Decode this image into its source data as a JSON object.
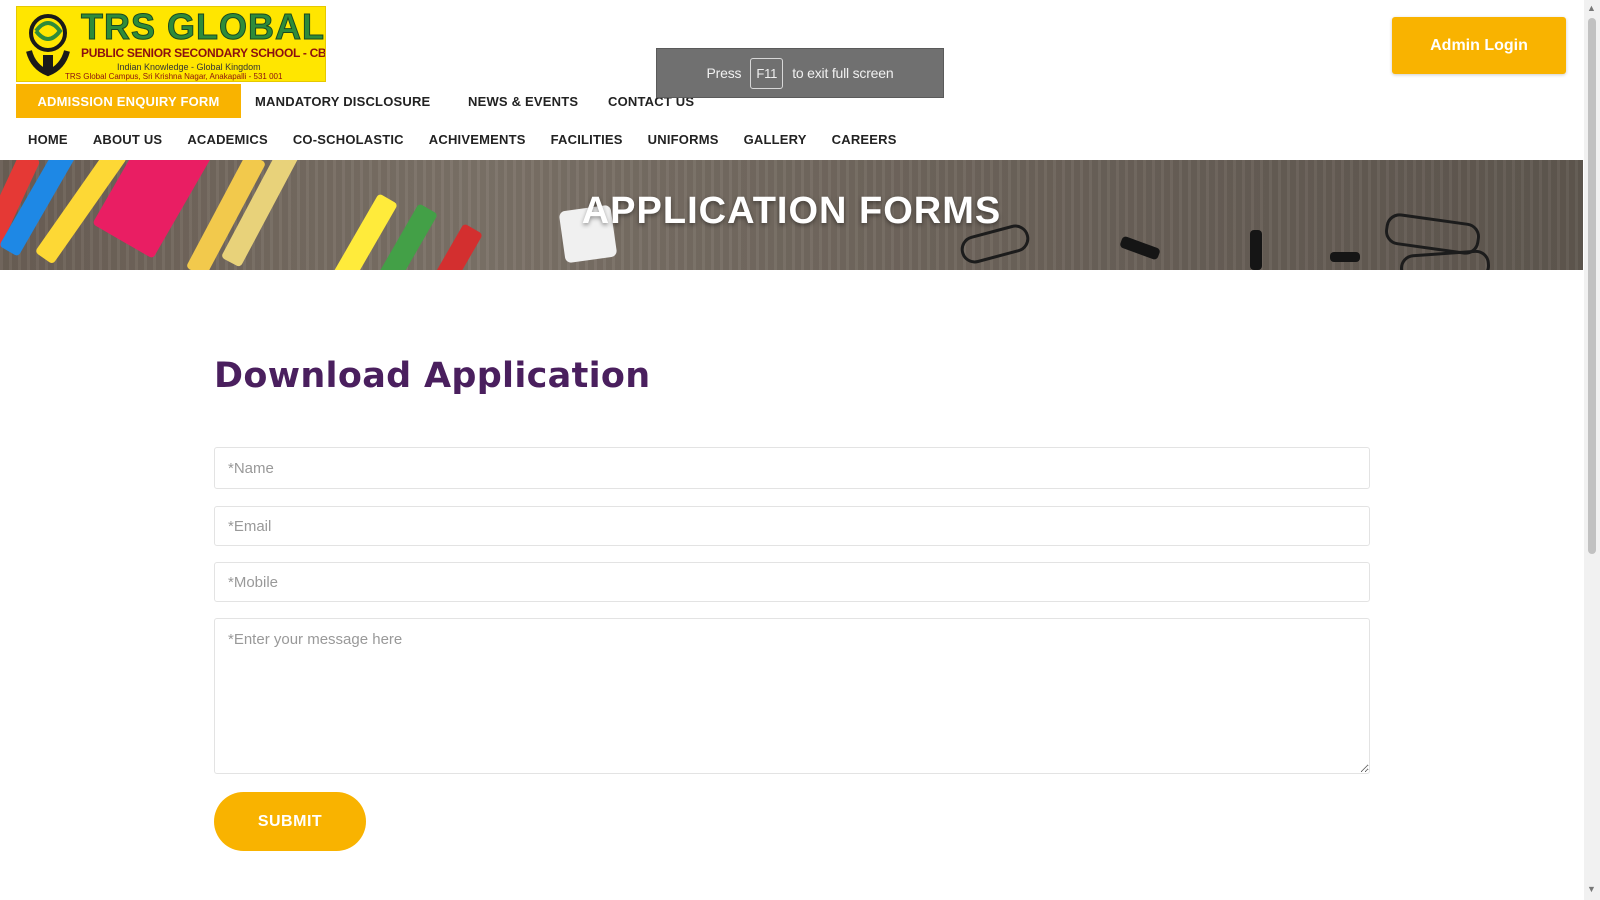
{
  "header": {
    "logo": {
      "title": "TRS GLOBAL",
      "subtitle": "PUBLIC SENIOR SECONDARY SCHOOL - CBSE",
      "tagline": "Indian Knowledge - Global Kingdom",
      "address": "TRS Global Campus, Sri Krishna Nagar, Anakapalli - 531 001"
    },
    "enquiry_label": "ADMISSION ENQUIRY FORM",
    "top_links": [
      "MANDATORY DISCLOSURE",
      "NEWS & EVENTS",
      "CONTACT US"
    ],
    "main_nav": [
      "HOME",
      "ABOUT US",
      "ACADEMICS",
      "CO-SCHOLASTIC",
      "ACHIVEMENTS",
      "FACILITIES",
      "UNIFORMS",
      "GALLERY",
      "CAREERS"
    ],
    "admin_login_label": "Admin Login"
  },
  "fullscreen_toast": {
    "press": "Press",
    "key": "F11",
    "suffix": "to exit full screen"
  },
  "banner": {
    "title": "APPLICATION FORMS"
  },
  "form": {
    "heading": "Download Application",
    "name_placeholder": "*Name",
    "email_placeholder": "*Email",
    "mobile_placeholder": "*Mobile",
    "message_placeholder": "*Enter your message here",
    "submit_label": "SUBMIT"
  },
  "colors": {
    "accent": "#f9b300",
    "heading": "#4a1f5e",
    "logo_bg": "#ffe600"
  }
}
